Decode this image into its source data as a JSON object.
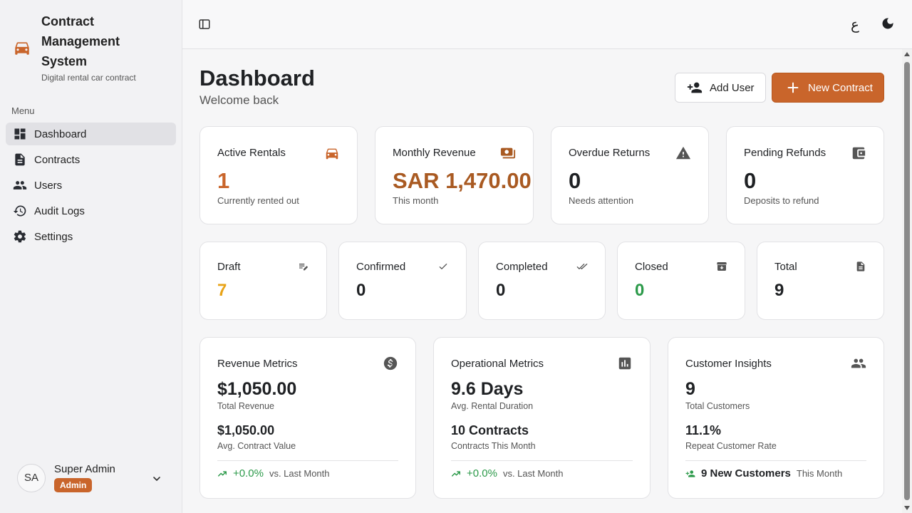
{
  "colors": {
    "accent": "#c9652b",
    "revenue": "#a95a22",
    "draft": "#e8a317",
    "closed": "#2c9a4a",
    "positive": "#2c9a4a"
  },
  "brand": {
    "title": "Contract Management System",
    "subtitle": "Digital rental car contract",
    "icon": "car-icon"
  },
  "sidebar": {
    "menu_label": "Menu",
    "items": [
      {
        "label": "Dashboard",
        "icon": "dashboard-icon",
        "active": true
      },
      {
        "label": "Contracts",
        "icon": "document-icon"
      },
      {
        "label": "Users",
        "icon": "users-icon"
      },
      {
        "label": "Audit Logs",
        "icon": "history-icon"
      },
      {
        "label": "Settings",
        "icon": "gear-icon"
      }
    ]
  },
  "user": {
    "initials": "SA",
    "name": "Super Admin",
    "role": "Admin"
  },
  "topbar": {
    "language_toggle": "ع",
    "sidebar_toggle_icon": "sidebar-toggle-icon",
    "theme_icon": "moon-icon"
  },
  "header": {
    "title": "Dashboard",
    "subtitle": "Welcome back",
    "add_user": "Add User",
    "new_contract": "New Contract"
  },
  "stats": [
    {
      "title": "Active Rentals",
      "value": "1",
      "sub": "Currently rented out",
      "icon": "car-icon"
    },
    {
      "title": "Monthly Revenue",
      "value": "SAR 1,470.00",
      "sub": "This month",
      "icon": "money-icon"
    },
    {
      "title": "Overdue Returns",
      "value": "0",
      "sub": "Needs attention",
      "icon": "warning-icon"
    },
    {
      "title": "Pending Refunds",
      "value": "0",
      "sub": "Deposits to refund",
      "icon": "wallet-icon"
    }
  ],
  "status_cards": [
    {
      "title": "Draft",
      "value": "7",
      "icon": "edit-list-icon"
    },
    {
      "title": "Confirmed",
      "value": "0",
      "icon": "check-icon"
    },
    {
      "title": "Completed",
      "value": "0",
      "icon": "double-check-icon"
    },
    {
      "title": "Closed",
      "value": "0",
      "icon": "archive-icon"
    },
    {
      "title": "Total",
      "value": "9",
      "icon": "file-icon"
    }
  ],
  "metrics": [
    {
      "title": "Revenue Metrics",
      "icon": "dollar-icon",
      "big": "$1,050.00",
      "big_label": "Total Revenue",
      "mid": "$1,050.00",
      "mid_label": "Avg. Contract Value",
      "foot_value": "+0.0%",
      "foot_label": "vs. Last Month"
    },
    {
      "title": "Operational Metrics",
      "icon": "bar-chart-icon",
      "big": "9.6 Days",
      "big_label": "Avg. Rental Duration",
      "mid": "10 Contracts",
      "mid_label": "Contracts This Month",
      "foot_value": "+0.0%",
      "foot_label": "vs. Last Month"
    },
    {
      "title": "Customer Insights",
      "icon": "users-icon",
      "big": "9",
      "big_label": "Total Customers",
      "mid": "11.1%",
      "mid_label": "Repeat Customer Rate",
      "foot_value": "9 New Customers",
      "foot_label": "This Month"
    }
  ]
}
